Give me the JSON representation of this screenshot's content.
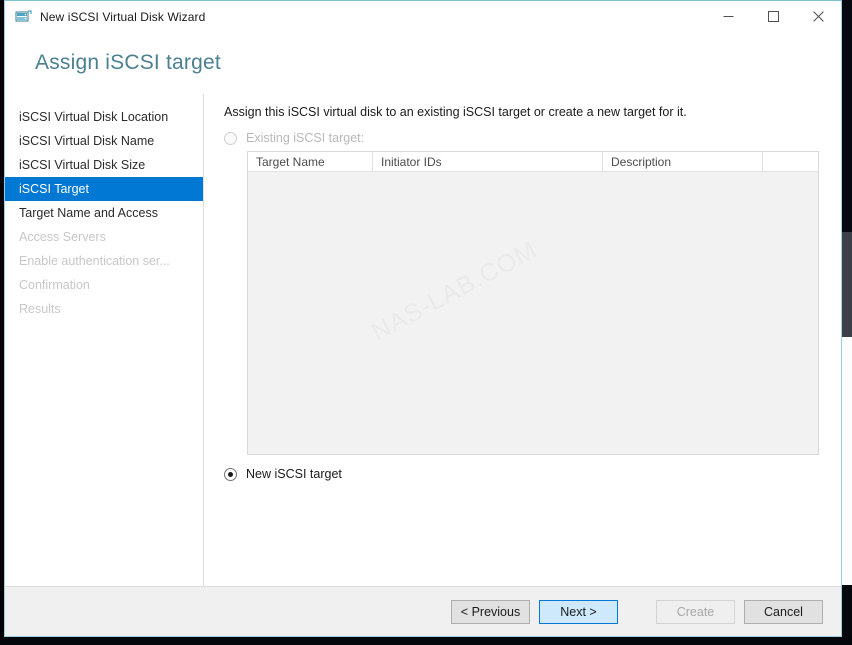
{
  "window": {
    "title": "New iSCSI Virtual Disk Wizard",
    "icon": "iscsi-disk-icon",
    "controls": {
      "minimize": "minimize-icon",
      "maximize": "maximize-icon",
      "close": "close-icon"
    }
  },
  "header": {
    "page_title": "Assign iSCSI target",
    "accent_color": "#4b8091"
  },
  "sidebar": {
    "items": [
      {
        "label": "iSCSI Virtual Disk Location",
        "state": "normal"
      },
      {
        "label": "iSCSI Virtual Disk Name",
        "state": "normal"
      },
      {
        "label": "iSCSI Virtual Disk Size",
        "state": "normal"
      },
      {
        "label": "iSCSI Target",
        "state": "selected"
      },
      {
        "label": "Target Name and Access",
        "state": "normal"
      },
      {
        "label": "Access Servers",
        "state": "disabled"
      },
      {
        "label": "Enable authentication ser...",
        "state": "disabled"
      },
      {
        "label": "Confirmation",
        "state": "disabled"
      },
      {
        "label": "Results",
        "state": "disabled"
      }
    ],
    "selected_color": "#0078d4"
  },
  "main": {
    "intro": "Assign this iSCSI virtual disk to an existing iSCSI target or create a new target for it.",
    "existing_target": {
      "label": "Existing iSCSI target:",
      "checked": false,
      "disabled": true
    },
    "new_target": {
      "label": "New iSCSI target",
      "checked": true,
      "disabled": false
    },
    "table": {
      "columns": [
        "Target Name",
        "Initiator IDs",
        "Description",
        ""
      ],
      "rows": [],
      "watermark": "NAS-LAB.COM"
    }
  },
  "footer": {
    "buttons": [
      {
        "label": "< Previous",
        "style": "normal"
      },
      {
        "label": "Next >",
        "style": "default"
      },
      {
        "label": "Create",
        "style": "disabled"
      },
      {
        "label": "Cancel",
        "style": "normal"
      }
    ]
  }
}
